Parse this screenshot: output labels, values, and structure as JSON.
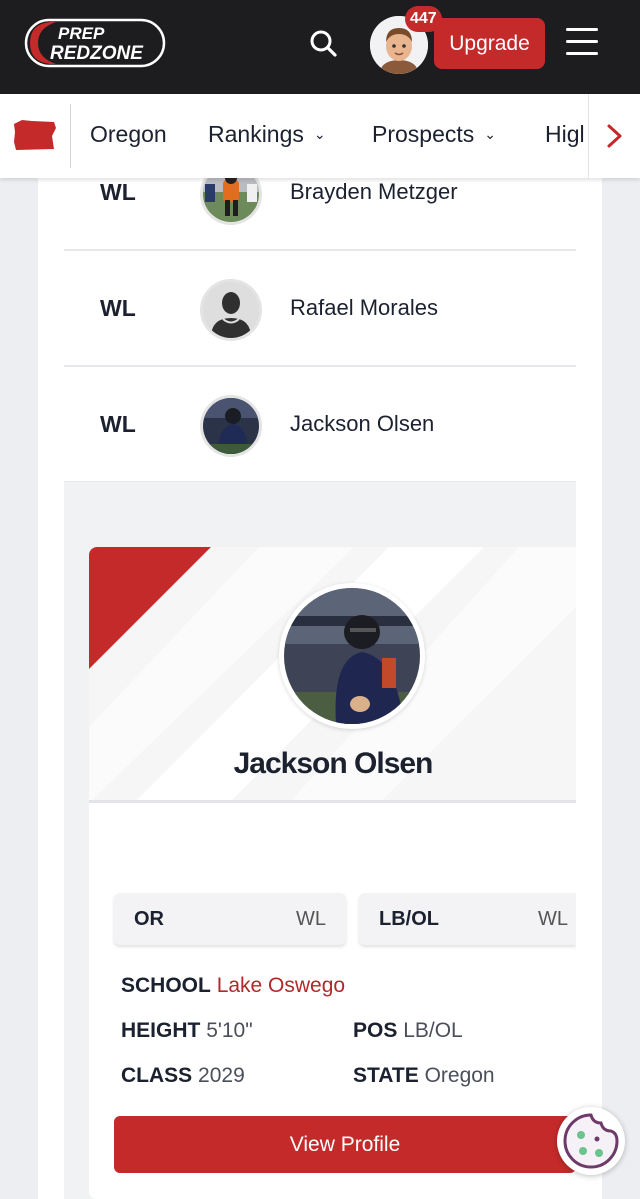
{
  "header": {
    "logo_line1": "PREP",
    "logo_line2": "REDZONE",
    "notification_count": "447",
    "upgrade_label": "Upgrade"
  },
  "nav": {
    "items": [
      {
        "label": "Oregon"
      },
      {
        "label": "Rankings"
      },
      {
        "label": "Prospects"
      },
      {
        "label": "Higl"
      }
    ]
  },
  "rankings": {
    "rows": [
      {
        "rank": "WL",
        "name": "Brayden Metzger"
      },
      {
        "rank": "WL",
        "name": "Rafael Morales"
      },
      {
        "rank": "WL",
        "name": "Jackson Olsen"
      }
    ]
  },
  "profile": {
    "name": "Jackson Olsen",
    "state_chip": {
      "label": "OR",
      "value": "WL"
    },
    "position_chip": {
      "label": "LB/OL",
      "value": "WL"
    },
    "school_label": "SCHOOL",
    "school": "Lake Oswego",
    "height_label": "HEIGHT",
    "height": "5'10\"",
    "pos_label": "POS",
    "pos": "LB/OL",
    "class_label": "CLASS",
    "class_year": "2029",
    "state_label": "STATE",
    "state": "Oregon",
    "view_profile_label": "View Profile"
  },
  "colors": {
    "brand_red": "#c42a2a",
    "header_bg": "#1d1d1f",
    "link_red": "#b02a2a"
  },
  "icons": [
    "search-icon",
    "hamburger-menu-icon",
    "oregon-state-icon",
    "chevron-down-icon",
    "chevron-right-icon",
    "cookie-icon"
  ]
}
